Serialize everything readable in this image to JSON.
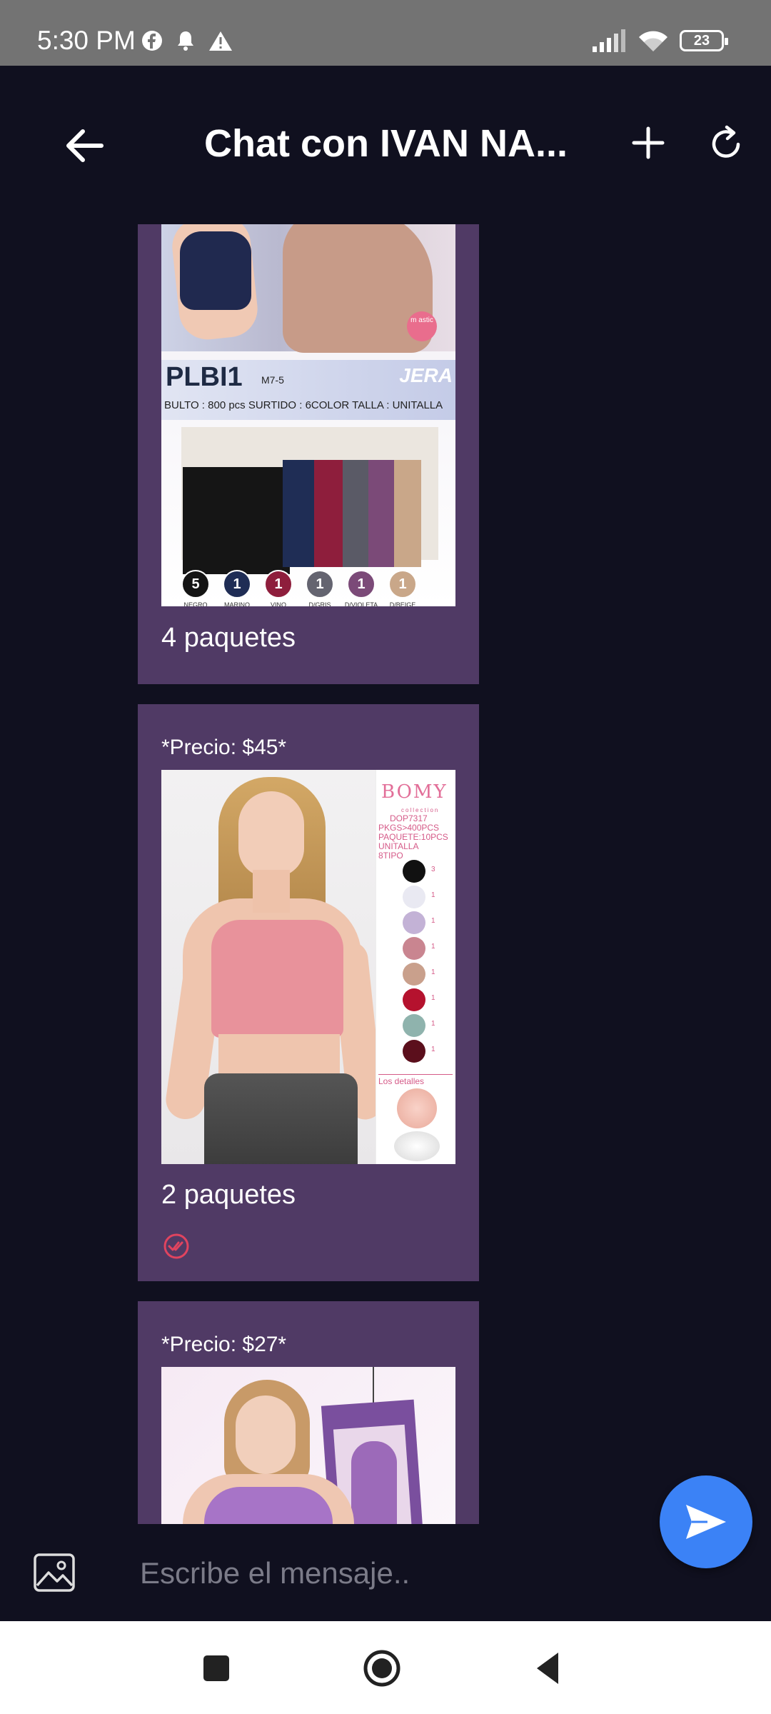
{
  "status_bar": {
    "time": "5:30 PM",
    "icons_left": [
      "facebook-icon",
      "bell-icon",
      "warning-icon"
    ],
    "icons_right": [
      "signal-icon",
      "wifi-icon",
      "battery-icon"
    ],
    "battery_level": "23"
  },
  "header": {
    "title": "Chat con IVAN NA...",
    "back_icon": "arrow-left-icon",
    "add_icon": "plus-icon",
    "refresh_icon": "refresh-icon"
  },
  "messages": [
    {
      "image_texts": {
        "code": "PLBI1",
        "model": "M7-5",
        "brand": "JERA",
        "specs": "BULTO : 800 pcs    SURTIDO : 6COLOR    TALLA : UNITALLA",
        "stamp": "m astic"
      },
      "colors": [
        {
          "count": "5",
          "label": "NEGRO",
          "hex": "#141414"
        },
        {
          "count": "1",
          "label": "MARINO",
          "hex": "#1f2d55"
        },
        {
          "count": "1",
          "label": "VINO",
          "hex": "#8e1e3c"
        },
        {
          "count": "1",
          "label": "D/GRIS",
          "hex": "#646470"
        },
        {
          "count": "1",
          "label": "D/VIOLETA",
          "hex": "#7b4a78"
        },
        {
          "count": "1",
          "label": "D/BEIGE",
          "hex": "#c9a789"
        }
      ],
      "text": "4 paquetes"
    },
    {
      "caption": "*Precio: $45*",
      "image_texts": {
        "brand": "BOMY",
        "sub": "collection",
        "lines": [
          "DOP7317",
          "PKGS>400PCS",
          "PAQUETE:10PCS",
          "UNITALLA",
          "8TIPO"
        ],
        "details": "Los detalles"
      },
      "swatches": [
        {
          "count": "3",
          "hex": "#111111"
        },
        {
          "count": "1",
          "hex": "#e9e9f2"
        },
        {
          "count": "1",
          "hex": "#c3b2d6"
        },
        {
          "count": "1",
          "hex": "#c98590"
        },
        {
          "count": "1",
          "hex": "#c9a08c"
        },
        {
          "count": "1",
          "hex": "#b5122e"
        },
        {
          "count": "1",
          "hex": "#8fb3ad"
        },
        {
          "count": "1",
          "hex": "#5b0f1c"
        }
      ],
      "text": "2 paquetes",
      "status_icon": "double-check-icon"
    },
    {
      "caption": "*Precio: $27*"
    }
  ],
  "input": {
    "placeholder": "Escribe el mensaje..",
    "gallery_icon": "image-icon",
    "send_icon": "send-icon"
  },
  "nav": {
    "recent_icon": "square-icon",
    "home_icon": "circle-icon",
    "back_icon": "triangle-back-icon"
  }
}
